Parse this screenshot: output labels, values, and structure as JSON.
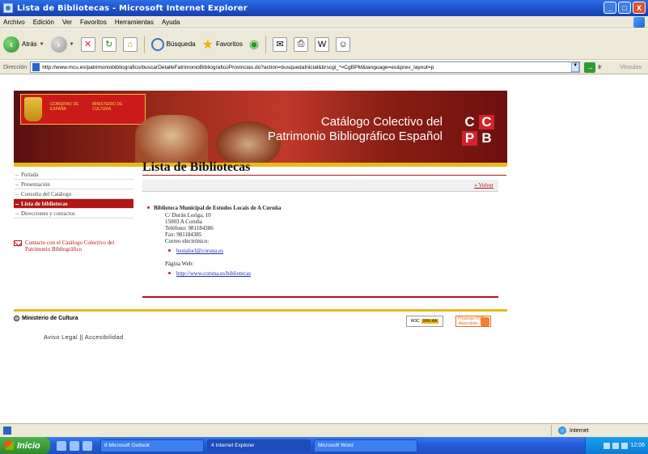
{
  "window": {
    "title": "Lista de Bibliotecas - Microsoft Internet Explorer",
    "controls": [
      "_",
      "□",
      "X"
    ]
  },
  "menu": [
    "Archivo",
    "Edición",
    "Ver",
    "Favoritos",
    "Herramientas",
    "Ayuda"
  ],
  "toolbar": {
    "back_label": "Atrás",
    "search_label": "Búsqueda",
    "favorites_label": "Favoritos"
  },
  "address": {
    "label": "Dirección",
    "url": "http://www.mcu.es/patrimoniobibliografico/buscarDetalleFatrimonioBibliograficoProvincias.do?action=busquedaInicial&brscgi_*=CgBPM&language=es&prev_layout=p",
    "go_label": "Ir",
    "links_label": "Vínculos"
  },
  "banner": {
    "gov_text": "GOBIERNO DE ESPAÑA",
    "ministry_text": "MINISTERIO DE CULTURA",
    "title_line1": "Catálogo Colectivo del",
    "title_line2": "Patrimonio Bibliográfico Español",
    "logo": [
      "C",
      "C",
      "P",
      "B"
    ]
  },
  "nav": {
    "items": [
      "Portada",
      "Presentación",
      "Consulta del Catálogo",
      "Lista de bibliotecas",
      "Direcciones y contactos"
    ],
    "active_index": 3,
    "contact": "Contacto con el Catálogo Colectivo del Patrimonio Bibliográfico"
  },
  "content": {
    "title": "Lista de Bibliotecas",
    "volver": "« Volver",
    "library": {
      "name": "Biblioteca Municipal de Estudos Locais de A Coruña",
      "address": "C/ Durán Loriga, 10",
      "city": "15003 A Coruña",
      "phone": "Teléfono: 981184386",
      "fax": "Fax: 981184385",
      "email_label": "Correo electrónico:",
      "email": "bestalocl@coruna.es",
      "web_label": "Página Web:",
      "web": "http://www.coruna.es/bibliotecas"
    }
  },
  "footer": {
    "ministry": "Ministerio de Cultura",
    "wai_label": "WAI-AA",
    "w3c": "W3C",
    "rss_label": "Próximas RSS disponibles",
    "links": "Aviso Legal || Accesibilidad"
  },
  "status": {
    "zone": "Internet"
  },
  "taskbar": {
    "start": "Inicio",
    "tasks": [
      "8 Microsoft Outlook",
      "4 Internet Explorer",
      "Microsoft Word"
    ],
    "clock": "12:06"
  }
}
